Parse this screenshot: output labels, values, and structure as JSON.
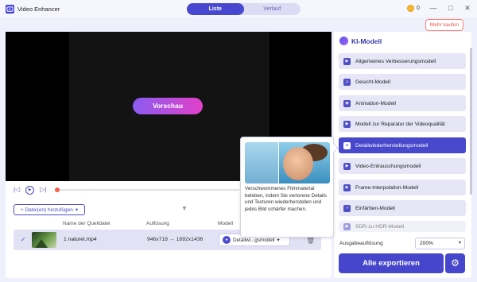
{
  "window": {
    "title": "Video Enhancer",
    "controls": [
      "—",
      "□",
      "✕"
    ]
  },
  "tabs": [
    {
      "label": "Liste",
      "active": true
    },
    {
      "label": "Verlauf",
      "active": false
    }
  ],
  "header": {
    "credits": "0",
    "buy_label": "Mehr kaufen"
  },
  "preview": {
    "button_label": "Vorschau"
  },
  "player": {
    "prev": "|◁",
    "play": "▶",
    "next": "▷|",
    "progress": 0.0
  },
  "file_list": {
    "add_label": "+ Datei(en) hinzufügen",
    "add_caret": "▾",
    "collapse_glyph": "⩔",
    "columns": [
      "Name der Quelldatei",
      "Auflösung",
      "Modell"
    ],
    "rows": [
      {
        "checked": true,
        "check_glyph": "✓",
        "name": "1 naturel.mp4",
        "resolution": "946x718  →  1892x1436",
        "model": "Detailwi...gsmodell",
        "model_caret": "▾",
        "delete_glyph": "🗑"
      }
    ]
  },
  "ai_panel": {
    "title": "KI-Modell",
    "models": [
      {
        "label": "Allgemeines Verbesserungsmodell",
        "active": false
      },
      {
        "label": "Gesicht-Modell",
        "active": false
      },
      {
        "label": "Animation-Modell",
        "active": false
      },
      {
        "label": "Modell zur Reparatur der Videoqualität",
        "active": false
      },
      {
        "label": "Detailwiederherstellungsmodell",
        "active": true
      },
      {
        "label": "Video-Entrauschungsmodell",
        "active": false
      },
      {
        "label": "Frame-Interpolation-Modell",
        "active": false
      },
      {
        "label": "Einfärben-Modell",
        "active": false
      },
      {
        "label": "SDR-zu-HDR-Modell",
        "active": false,
        "disabled": true
      }
    ],
    "output_resolution_label": "Ausgabeauflösung",
    "output_resolution_value": "200%",
    "output_caret": "▾",
    "export_label": "Alle exportieren",
    "settings_glyph": "⚙"
  },
  "tooltip": {
    "text": "Verschwommenes Filmmaterial beleben, indem Sie verlorene Details und Texturen wiederherstellen und jedes Bild schärfer machen."
  },
  "colors": {
    "accent": "#4848cc",
    "highlight": "#f45d4c",
    "preview_gradient": [
      "#8a5cf0",
      "#e240c9"
    ]
  }
}
